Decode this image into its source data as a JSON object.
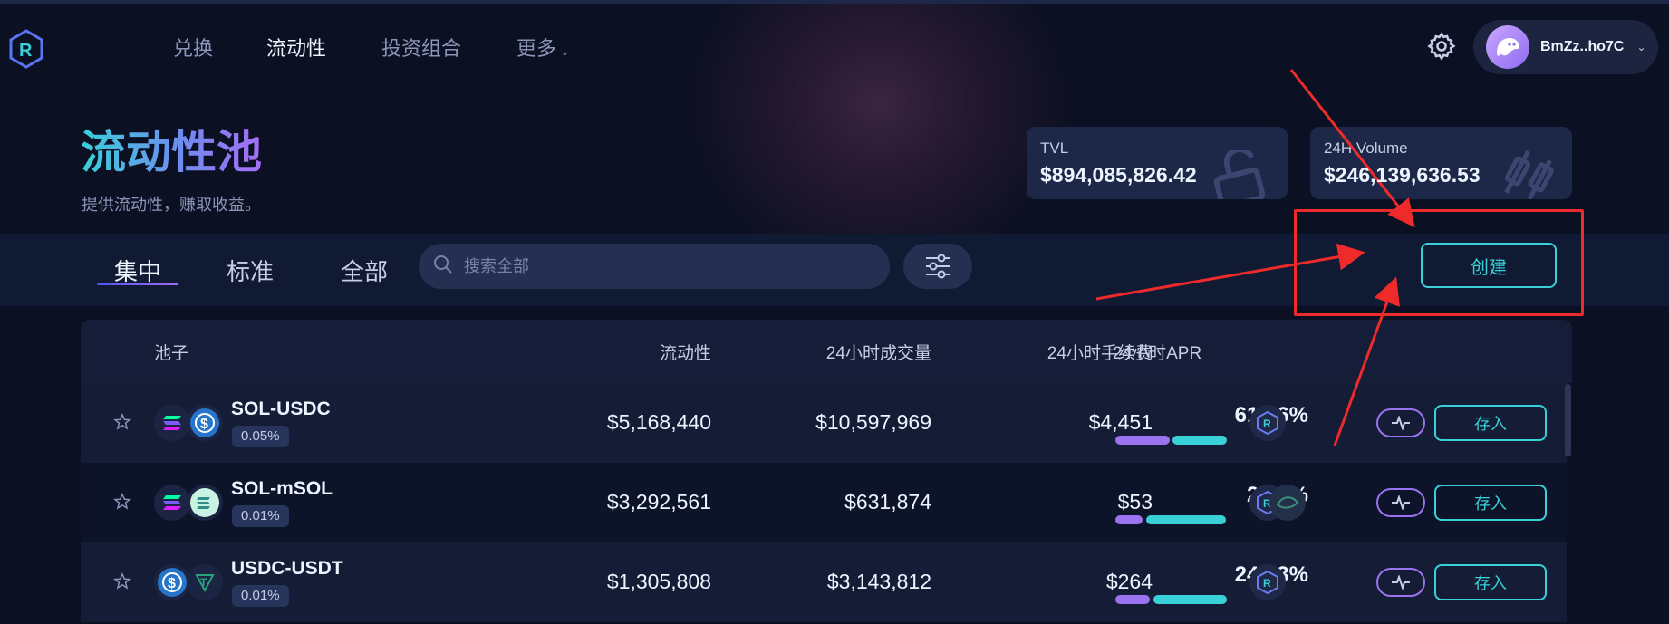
{
  "nav": {
    "items": [
      "兑换",
      "流动性",
      "投资组合",
      "更多"
    ],
    "active": "流动性",
    "wallet_address": "BmZz..ho7C",
    "icons": [
      "raydium-logo-icon",
      "gear-icon",
      "chevron-down-icon"
    ]
  },
  "hero": {
    "title": "流动性池",
    "subtitle": "提供流动性，赚取收益。",
    "tvl_label": "TVL",
    "tvl_value": "$894,085,826.42",
    "volume_label": "24H Volume",
    "volume_value": "$246,139,636.53"
  },
  "filters": {
    "tabs": [
      "集中",
      "标准",
      "全部"
    ],
    "active_tab": "集中",
    "search_placeholder": "搜索全部",
    "create_label": "创建"
  },
  "table": {
    "headers": [
      "池子",
      "流动性",
      "24小时成交量",
      "24小时手续费",
      "24小时APR"
    ],
    "rows": [
      {
        "pair": "SOL-USDC",
        "fee": "0.05%",
        "liquidity": "$5,168,440",
        "volume": "$10,597,969",
        "fees": "$4,451",
        "apr": "61.96%",
        "deposit": "存入"
      },
      {
        "pair": "SOL-mSOL",
        "fee": "0.01%",
        "liquidity": "$3,292,561",
        "volume": "$631,874",
        "fees": "$53",
        "apr": "2.19%",
        "deposit": "存入"
      },
      {
        "pair": "USDC-USDT",
        "fee": "0.01%",
        "liquidity": "$1,305,808",
        "volume": "$3,143,812",
        "fees": "$264",
        "apr": "24.93%",
        "deposit": "存入"
      }
    ]
  },
  "colors": {
    "accent_cyan": "#39d0d8",
    "accent_purple": "#9b73f0",
    "annotation_red": "#ee2a2a",
    "background": "#0b1022"
  }
}
